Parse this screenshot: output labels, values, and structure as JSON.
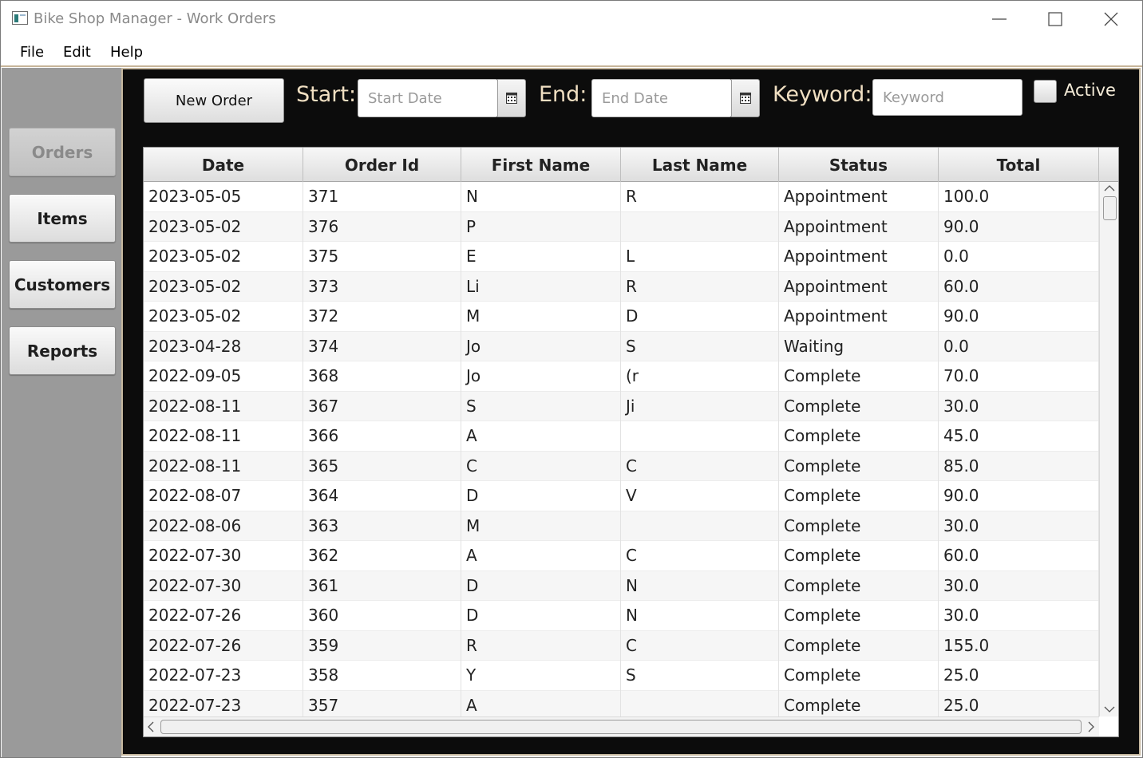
{
  "window": {
    "title": "Bike Shop Manager - Work Orders"
  },
  "menu": [
    "File",
    "Edit",
    "Help"
  ],
  "sidebar": {
    "items": [
      {
        "label": "Orders",
        "active": true
      },
      {
        "label": "Items",
        "active": false
      },
      {
        "label": "Customers",
        "active": false
      },
      {
        "label": "Reports",
        "active": false
      }
    ]
  },
  "toolbar": {
    "new_order_label": "New Order",
    "start_label": "Start:",
    "start_placeholder": "Start Date",
    "end_label": "End:",
    "end_placeholder": "End Date",
    "keyword_label": "Keyword:",
    "keyword_placeholder": "Keyword",
    "active_label": "Active",
    "active_checked": false
  },
  "table": {
    "columns": [
      "Date",
      "Order Id",
      "First Name",
      "Last Name",
      "Status",
      "Total"
    ],
    "rows": [
      [
        "2023-05-05",
        "371",
        "N",
        "R",
        "Appointment",
        "100.0"
      ],
      [
        "2023-05-02",
        "376",
        "P",
        "",
        "Appointment",
        "90.0"
      ],
      [
        "2023-05-02",
        "375",
        "E",
        "L",
        "Appointment",
        "0.0"
      ],
      [
        "2023-05-02",
        "373",
        "Li",
        "R",
        "Appointment",
        "60.0"
      ],
      [
        "2023-05-02",
        "372",
        "M",
        "D",
        "Appointment",
        "90.0"
      ],
      [
        "2023-04-28",
        "374",
        "Jo",
        "S",
        "Waiting",
        "0.0"
      ],
      [
        "2022-09-05",
        "368",
        "Jo",
        "(r",
        "Complete",
        "70.0"
      ],
      [
        "2022-08-11",
        "367",
        "S",
        "Ji",
        "Complete",
        "30.0"
      ],
      [
        "2022-08-11",
        "366",
        "A",
        "",
        "Complete",
        "45.0"
      ],
      [
        "2022-08-11",
        "365",
        "C",
        "C",
        "Complete",
        "85.0"
      ],
      [
        "2022-08-07",
        "364",
        "D",
        "V",
        "Complete",
        "90.0"
      ],
      [
        "2022-08-06",
        "363",
        "M",
        "",
        "Complete",
        "30.0"
      ],
      [
        "2022-07-30",
        "362",
        "A",
        "C",
        "Complete",
        "60.0"
      ],
      [
        "2022-07-30",
        "361",
        "D",
        "N",
        "Complete",
        "30.0"
      ],
      [
        "2022-07-26",
        "360",
        "D",
        "N",
        "Complete",
        "30.0"
      ],
      [
        "2022-07-26",
        "359",
        "R",
        "C",
        "Complete",
        "155.0"
      ],
      [
        "2022-07-23",
        "358",
        "Y",
        "S",
        "Complete",
        "25.0"
      ],
      [
        "2022-07-23",
        "357",
        "A",
        "",
        "Complete",
        "25.0"
      ]
    ]
  }
}
